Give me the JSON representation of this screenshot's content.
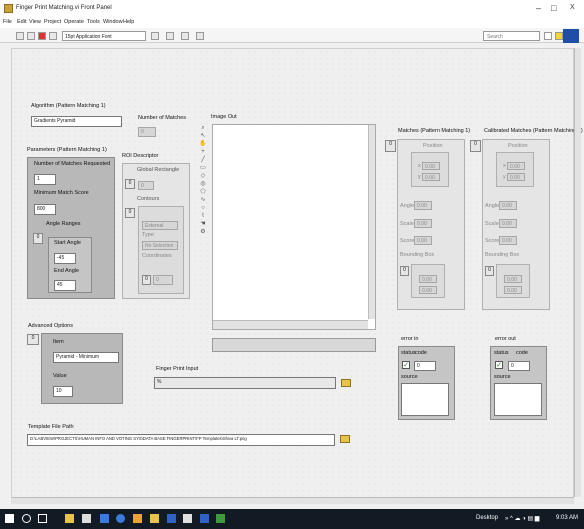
{
  "window": {
    "title": "Finger Print Matching.vi Front Panel",
    "minimize": "–",
    "maximize": "□",
    "close": "X"
  },
  "menu": [
    "File",
    "Edit",
    "View",
    "Project",
    "Operate",
    "Tools",
    "Window",
    "Help"
  ],
  "toolbar": {
    "font": "15pt Application Font",
    "search_placeholder": "Search"
  },
  "algorithm": {
    "label": "Algorithm (Pattern Matching 1)",
    "value": "Gradients Pyramid"
  },
  "num_matches": {
    "label": "Number of Matches",
    "value": "0"
  },
  "image_out": {
    "label": "Image Out"
  },
  "params": {
    "label": "Parameters (Pattern Matching 1)",
    "num_requested_label": "Number of Matches Requested",
    "num_requested_value": "1",
    "min_score_label": "Minimum Match Score",
    "min_score_value": "800",
    "angle_ranges_label": "Angle Ranges",
    "angle_index": "0",
    "start_angle_label": "Start Angle",
    "start_angle_value": "-45",
    "end_angle_label": "End Angle",
    "end_angle_value": "45"
  },
  "roi": {
    "label": "ROI Descriptor",
    "global_rect_label": "Global Rectangle",
    "global_rect_index": "0",
    "global_rect_value": "0",
    "contours_label": "Contours",
    "contours_index": "0",
    "external": "External",
    "type_label": "Type",
    "no_selection": "No Selection",
    "coordinates_label": "Coordinates",
    "coord_index": "0",
    "coord_value": "0"
  },
  "matches": {
    "label": "Matches (Pattern Matching 1)",
    "index": "0",
    "position_label": "Position",
    "x_label": "x",
    "x_value": "0.00",
    "y_label": "y",
    "y_value": "0.00",
    "angle_label": "Angle",
    "angle_value": "0.00",
    "scale_label": "Scale",
    "scale_value": "0.00",
    "score_label": "Score",
    "score_value": "0.00",
    "bbox_label": "Bounding Box",
    "bbox_index": "0",
    "bbox_x": "0.00",
    "bbox_y": "0.00"
  },
  "calibrated": {
    "label": "Calibrated Matches (Pattern Matching 1)",
    "index": "0",
    "position_label": "Position",
    "x_label": "x",
    "x_value": "0.00",
    "y_label": "y",
    "y_value": "0.00",
    "angle_label": "Angle",
    "angle_value": "0.00",
    "scale_label": "Scale",
    "scale_value": "0.00",
    "score_label": "Score",
    "score_value": "0.00",
    "bbox_label": "Bounding Box",
    "bbox_index": "0",
    "bbox_x": "0.00",
    "bbox_y": "0.00"
  },
  "advanced": {
    "label": "Advanced Options",
    "index": "0",
    "item_label": "Item",
    "item_value": "Pyramid - Minimum",
    "value_label": "Value",
    "value_value": "10"
  },
  "fingerprint": {
    "label": "Finger Print Input",
    "value": "%"
  },
  "error_in": {
    "label": "error in",
    "status_label": "status",
    "code_label": "code",
    "code_value": "0",
    "source_label": "source",
    "check": "✓"
  },
  "error_out": {
    "label": "error out",
    "status_label": "status",
    "code_label": "code",
    "code_value": "0",
    "source_label": "source",
    "check": "✓"
  },
  "template": {
    "label": "Template File Path",
    "value": "D:\\LABVIEW\\PROJECTS\\HUMAN INFO AND VOTING SYS\\DATA BASE FINGERPRINT\\FP Templates\\Shiva LT.png"
  },
  "taskbar": {
    "desktop": "Desktop",
    "time": "9:03 AM"
  }
}
